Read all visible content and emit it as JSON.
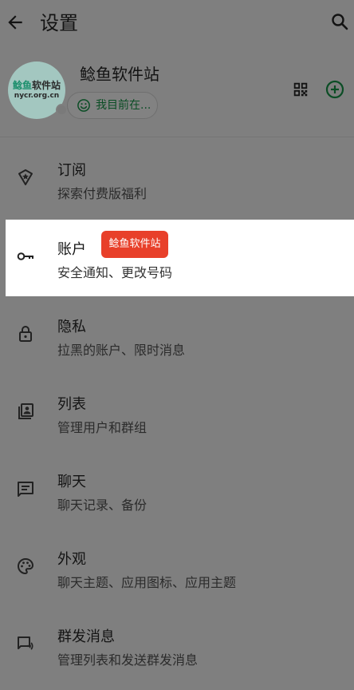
{
  "header": {
    "title": "设置"
  },
  "profile": {
    "name": "鲶鱼软件站",
    "avatar_logo_fish": "鲶鱼",
    "avatar_logo_rest": "软件站",
    "avatar_logo_domain": "nycr.org.cn",
    "status": "我目前在..."
  },
  "menu": [
    {
      "label": "订阅",
      "sub": "探索付费版福利",
      "icon": "star-badge-icon"
    },
    {
      "label": "账户",
      "sub": "安全通知、更改号码",
      "icon": "key-icon",
      "badge": "鲶鱼软件站"
    },
    {
      "label": "隐私",
      "sub": "拉黑的账户、限时消息",
      "icon": "lock-icon"
    },
    {
      "label": "列表",
      "sub": "管理用户和群组",
      "icon": "contacts-list-icon"
    },
    {
      "label": "聊天",
      "sub": "聊天记录、备份",
      "icon": "chat-icon"
    },
    {
      "label": "外观",
      "sub": "聊天主题、应用图标、应用主题",
      "icon": "palette-icon"
    },
    {
      "label": "群发消息",
      "sub": "管理列表和发送群发消息",
      "icon": "broadcast-icon"
    }
  ],
  "colors": {
    "background_dim": "#7f7f7f",
    "highlight": "#ffffff",
    "badge": "#e8402a",
    "accent_green": "#0b4d25"
  }
}
